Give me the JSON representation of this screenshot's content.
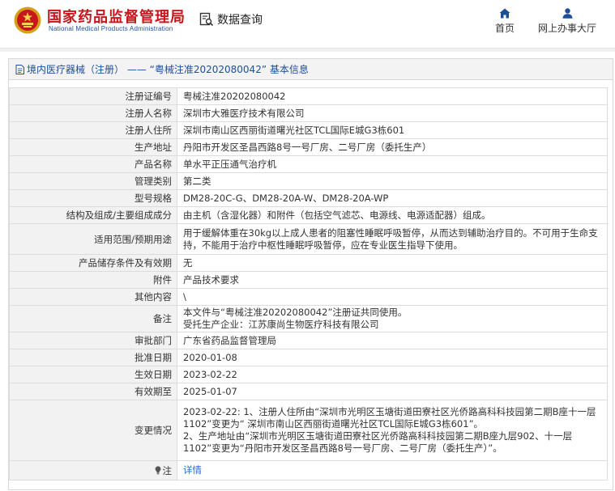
{
  "header": {
    "brand_cn": "国家药品监督管理局",
    "brand_en": "National Medical Products Administration",
    "query_label": "数据查询",
    "nav": [
      {
        "label": "首页",
        "icon": "home-icon"
      },
      {
        "label": "网上办事大厅",
        "icon": "user-icon"
      }
    ]
  },
  "panel": {
    "title": "境内医疗器械（注册） —— “粤械注准20202080042” 基本信息"
  },
  "rows": [
    {
      "key": "注册证编号",
      "value": "粤械注准20202080042"
    },
    {
      "key": "注册人名称",
      "value": "深圳市大雅医疗技术有限公司"
    },
    {
      "key": "注册人住所",
      "value": "深圳市南山区西丽街道曙光社区TCL国际E城G3栋601"
    },
    {
      "key": "生产地址",
      "value": "丹阳市开发区圣昌西路8号一号厂房、二号厂房（委托生产）"
    },
    {
      "key": "产品名称",
      "value": "单水平正压通气治疗机"
    },
    {
      "key": "管理类别",
      "value": "第二类"
    },
    {
      "key": "型号规格",
      "value": "DM28-20C-G、DM28-20A-W、DM28-20A-WP"
    },
    {
      "key": "结构及组成/主要组成成分",
      "value": "由主机（含湿化器）和附件（包括空气滤芯、电源线、电源适配器）组成。"
    },
    {
      "key": "适用范围/预期用途",
      "value": "用于缓解体重在30kg以上成人患者的阻塞性睡眠呼吸暂停，从而达到辅助治疗目的。不可用于生命支持，不能用于治疗中枢性睡眠呼吸暂停，应在专业医生指导下使用。"
    },
    {
      "key": "产品储存条件及有效期",
      "value": "无"
    },
    {
      "key": "附件",
      "value": "产品技术要求"
    },
    {
      "key": "其他内容",
      "value": "\\"
    },
    {
      "key": "备注",
      "value_lines": [
        "本文件与“粤械注准20202080042”注册证共同使用。",
        "受托生产企业：江苏康尚生物医疗科技有限公司"
      ]
    },
    {
      "key": "审批部门",
      "value": "广东省药品监督管理局"
    },
    {
      "key": "批准日期",
      "value": "2020-01-08"
    },
    {
      "key": "生效日期",
      "value": "2023-02-22"
    },
    {
      "key": "有效期至",
      "value": "2025-01-07"
    },
    {
      "key": "变更情况",
      "value_lines": [
        "2023-02-22: 1、注册人住所由“深圳市光明区玉塘街道田寮社区光侨路高科科技园第二期B座十一层1102”变更为“ 深圳市南山区西丽街道曙光社区TCL国际E城G3栋601”。",
        "2、生产地址由“深圳市光明区玉塘街道田寮社区光侨路高科科技园第二期B座九层902、十一层1102”变更为“丹阳市开发区圣昌西路8号一号厂房、二号厂房（委托生产）”。"
      ]
    },
    {
      "key": "注",
      "value": "详情",
      "icon": "lightbulb-icon",
      "link": true
    }
  ]
}
